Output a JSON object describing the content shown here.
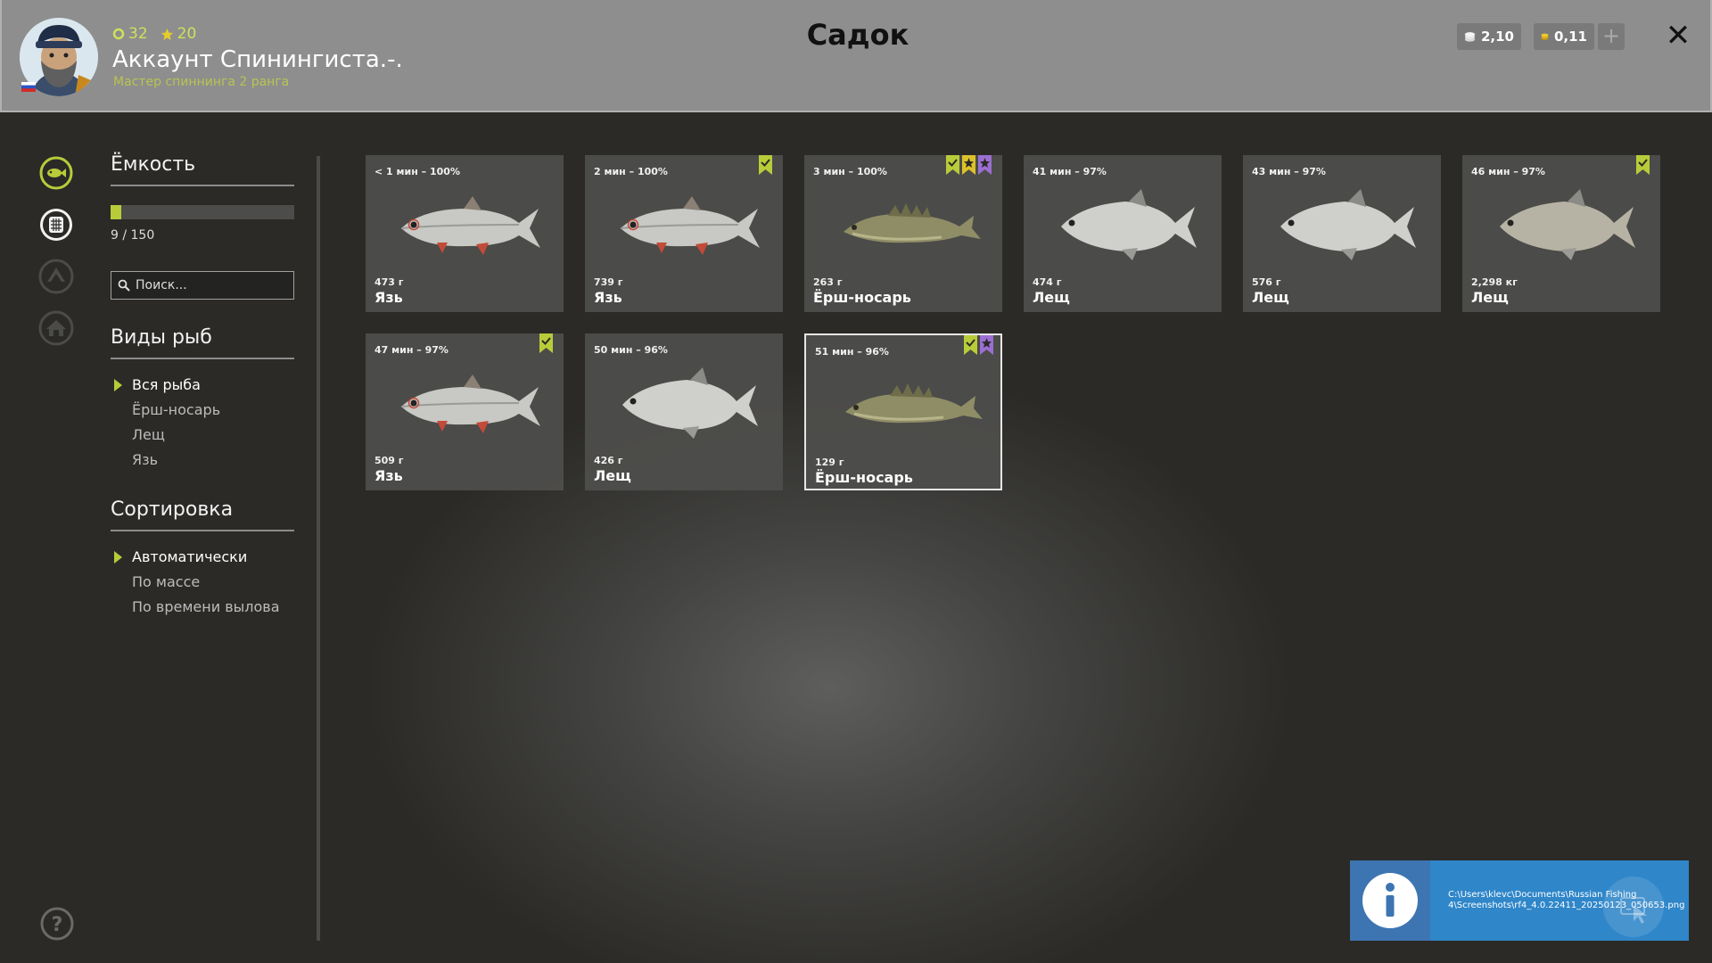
{
  "header": {
    "stat_level": "32",
    "stat_stars": "20",
    "account_name": "Аккаунт Спинингиста.-.",
    "rank": "Мастер спиннинга 2 ранга",
    "title": "Садок",
    "silver": "2,10",
    "gold": "0,11",
    "plus": "+",
    "close": "✕"
  },
  "panel": {
    "capacity_title": "Ёмкость",
    "capacity_text": "9 / 150",
    "capacity_fraction": 0.06,
    "search_placeholder": "Поиск...",
    "species_title": "Виды рыб",
    "species": [
      "Вся рыба",
      "Ёрш-носарь",
      "Лещ",
      "Язь"
    ],
    "sort_title": "Сортировка",
    "sort": [
      "Автоматически",
      "По массе",
      "По времени вылова"
    ]
  },
  "fish": [
    {
      "time": "< 1 мин – 100%",
      "weight": "473 г",
      "name": "Язь",
      "kind": "ide",
      "badges": []
    },
    {
      "time": "2 мин – 100%",
      "weight": "739 г",
      "name": "Язь",
      "kind": "ide",
      "badges": [
        "green"
      ]
    },
    {
      "time": "3 мин – 100%",
      "weight": "263 г",
      "name": "Ёрш-носарь",
      "kind": "ruffe",
      "badges": [
        "green",
        "yellow-star",
        "purple-star"
      ]
    },
    {
      "time": "41 мин – 97%",
      "weight": "474 г",
      "name": "Лещ",
      "kind": "bream",
      "badges": []
    },
    {
      "time": "43 мин – 97%",
      "weight": "576 г",
      "name": "Лещ",
      "kind": "bream",
      "badges": []
    },
    {
      "time": "46 мин – 97%",
      "weight": "2,298 кг",
      "name": "Лещ",
      "kind": "bream2",
      "badges": [
        "green"
      ]
    },
    {
      "time": "47 мин – 97%",
      "weight": "509 г",
      "name": "Язь",
      "kind": "ide",
      "badges": [
        "green"
      ]
    },
    {
      "time": "50 мин – 96%",
      "weight": "426 г",
      "name": "Лещ",
      "kind": "bream",
      "badges": []
    },
    {
      "time": "51 мин – 96%",
      "weight": "129 г",
      "name": "Ёрш-носарь",
      "kind": "ruffe",
      "badges": [
        "green",
        "purple-star"
      ]
    }
  ],
  "notification": {
    "path": "C:\\Users\\klevc\\Documents\\Russian Fishing 4\\Screenshots\\rf4_4.0.22411_20250123_050653.png"
  }
}
